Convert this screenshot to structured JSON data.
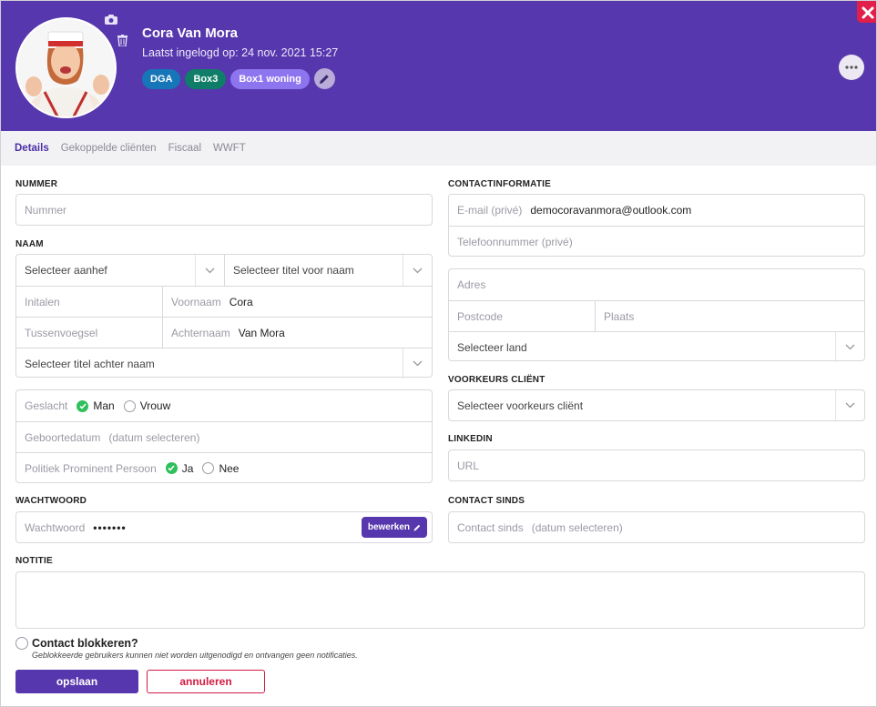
{
  "profile": {
    "name": "Cora Van Mora",
    "last_login": "Laatst ingelogd op: 24 nov. 2021 15:27",
    "tags": [
      {
        "label": "DGA",
        "color": "#1676b8"
      },
      {
        "label": "Box3",
        "color": "#0f7d67"
      },
      {
        "label": "Box1 woning",
        "color": "#8d75f0"
      }
    ]
  },
  "tabs": [
    "Details",
    "Gekoppelde cliënten",
    "Fiscaal",
    "WWFT"
  ],
  "sections": {
    "nummer": "NUMMER",
    "naam": "NAAM",
    "wachtwoord": "WACHTWOORD",
    "notitie": "NOTITIE",
    "contactinformatie": "CONTACTINFORMATIE",
    "voorkeurs": "VOORKEURS CLIËNT",
    "linkedin": "LINKEDIN",
    "contact_sinds": "CONTACT SINDS"
  },
  "fields": {
    "nummer_ph": "Nummer",
    "aanhef_ph": "Selecteer aanhef",
    "titel_voor_ph": "Selecteer titel voor naam",
    "initialen_ph": "Initalen",
    "voornaam_label": "Voornaam",
    "voornaam_value": "Cora",
    "tussenvoegsel_ph": "Tussenvoegsel",
    "achternaam_label": "Achternaam",
    "achternaam_value": "Van Mora",
    "titel_achter_ph": "Selecteer titel achter naam",
    "geslacht_label": "Geslacht",
    "geslacht_man": "Man",
    "geslacht_vrouw": "Vrouw",
    "geboortedatum_label": "Geboortedatum",
    "geboortedatum_ph": "(datum selecteren)",
    "pep_label": "Politiek Prominent Persoon",
    "pep_ja": "Ja",
    "pep_nee": "Nee",
    "wachtwoord_label": "Wachtwoord",
    "wachtwoord_value": "•••••••",
    "bewerken": "bewerken",
    "email_label": "E-mail (privé)",
    "email_value": "democoravanmora@outlook.com",
    "telefoon_ph": "Telefoonnummer (privé)",
    "adres_ph": "Adres",
    "postcode_ph": "Postcode",
    "plaats_ph": "Plaats",
    "land_ph": "Selecteer land",
    "voorkeurs_ph": "Selecteer voorkeurs cliënt",
    "url_ph": "URL",
    "contact_sinds_label": "Contact sinds",
    "contact_sinds_ph": "(datum selecteren)"
  },
  "block": {
    "title": "Contact blokkeren?",
    "subtitle": "Geblokkeerde gebruikers kunnen niet worden uitgenodigd en ontvangen geen notificaties."
  },
  "buttons": {
    "save": "opslaan",
    "cancel": "annuleren"
  },
  "icons": [
    "camera-icon",
    "trash-icon",
    "pencil-icon",
    "more-icon",
    "close-icon",
    "chevron-down-icon",
    "check-icon"
  ],
  "colors": {
    "header": "#5737ad",
    "accent": "#5737ad",
    "danger": "#d21b44",
    "check": "#2fbf5b"
  }
}
